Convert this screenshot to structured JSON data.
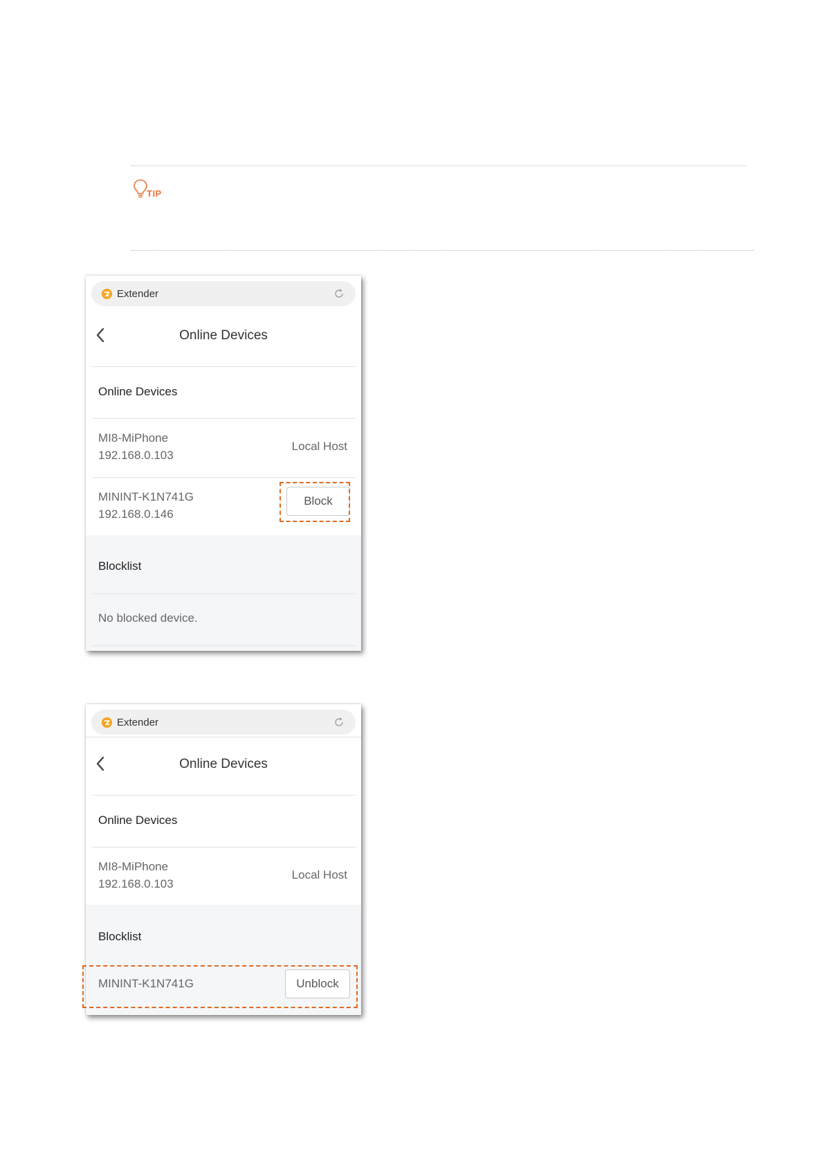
{
  "tip": {
    "label": "TIP"
  },
  "screens": [
    {
      "app_title": "Extender",
      "page_title": "Online Devices",
      "online_section": "Online Devices",
      "devices": [
        {
          "name": "MI8-MiPhone",
          "ip": "192.168.0.103",
          "status": "Local Host"
        },
        {
          "name": "MININT-K1N741G",
          "ip": "192.168.0.146",
          "action": "Block"
        }
      ],
      "blocklist_section": "Blocklist",
      "blocklist_empty": "No blocked device."
    },
    {
      "app_title": "Extender",
      "page_title": "Online Devices",
      "online_section": "Online Devices",
      "devices": [
        {
          "name": "MI8-MiPhone",
          "ip": "192.168.0.103",
          "status": "Local Host"
        }
      ],
      "blocklist_section": "Blocklist",
      "blocked": [
        {
          "name": "MININT-K1N741G",
          "action": "Unblock"
        }
      ]
    }
  ],
  "colors": {
    "accent": "#e06a1e",
    "tip": "#e8743b"
  }
}
